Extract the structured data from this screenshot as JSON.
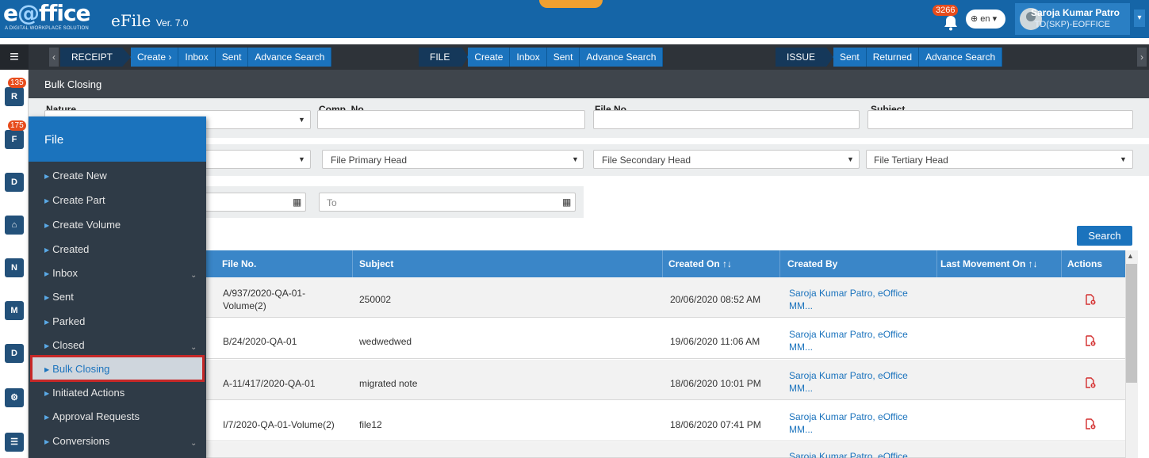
{
  "header": {
    "logo_text_prefix": "e",
    "logo_text_o": "@",
    "logo_text_suffix": "ffice",
    "logo_tagline": "A DIGITAL WORKPLACE SOLUTION",
    "app_title": "eFile",
    "version": "Ver. 7.0",
    "notification_count": "3266",
    "language": "en",
    "user_name": "Saroja Kumar Patro",
    "user_org": "TD(SKP)-EOFFICE"
  },
  "nav": {
    "receipt": {
      "label": "RECEIPT",
      "items": [
        "Create ›",
        "Inbox",
        "Sent",
        "Advance Search"
      ]
    },
    "file": {
      "label": "FILE",
      "items": [
        "Create",
        "Inbox",
        "Sent",
        "Advance Search"
      ]
    },
    "issue": {
      "label": "ISSUE",
      "items": [
        "Sent",
        "Returned",
        "Advance Search"
      ]
    }
  },
  "rail": {
    "receipt_badge": "135",
    "file_badge": "175",
    "icons": [
      "receipt-icon",
      "file-icon",
      "dispatch-icon",
      "inbox-tray-icon",
      "note-icon",
      "movement-icon",
      "dsc-icon",
      "settings-icon",
      "reports-icon"
    ]
  },
  "page": {
    "title": "Bulk Closing"
  },
  "form": {
    "nature_label": "Nature",
    "comp_no_label": "Comp. No.",
    "file_no_label": "File No.",
    "subject_label": "Subject",
    "primary_head": "File Primary Head",
    "secondary_head": "File Secondary Head",
    "tertiary_head": "File Tertiary Head",
    "to_placeholder": "To",
    "search_button": "Search"
  },
  "table": {
    "headers": {
      "file_no": "File No.",
      "subject": "Subject",
      "created_on": "Created On ↑↓",
      "created_by": "Created By",
      "last_movement": "Last Movement On ↑↓",
      "actions": "Actions"
    },
    "rows": [
      {
        "file_no_1": "A/937/2020-QA-01-",
        "file_no_2": "Volume(2)",
        "subject": "250002",
        "created_on": "20/06/2020 08:52 AM",
        "created_by_1": "Saroja Kumar Patro, eOffice",
        "created_by_2": "MM..."
      },
      {
        "file_no_1": "B/24/2020-QA-01",
        "file_no_2": "",
        "subject": "wedwedwed",
        "created_on": "19/06/2020 11:06 AM",
        "created_by_1": "Saroja Kumar Patro, eOffice",
        "created_by_2": "MM..."
      },
      {
        "file_no_1": "A-11/417/2020-QA-01",
        "file_no_2": "",
        "subject": "migrated note",
        "created_on": "18/06/2020 10:01 PM",
        "created_by_1": "Saroja Kumar Patro, eOffice",
        "created_by_2": "MM..."
      },
      {
        "file_no_1": "I/7/2020-QA-01-Volume(2)",
        "file_no_2": "",
        "subject": "file12",
        "created_on": "18/06/2020 07:41 PM",
        "created_by_1": "Saroja Kumar Patro, eOffice",
        "created_by_2": "MM..."
      },
      {
        "file_no_1": "",
        "file_no_2": "",
        "subject": "",
        "created_on": "",
        "created_by_1": "Saroja Kumar Patro, eOffice",
        "created_by_2": ""
      }
    ]
  },
  "side_menu": {
    "title": "File",
    "items": [
      {
        "label": "Create New",
        "has_chevron": false
      },
      {
        "label": "Create Part",
        "has_chevron": false
      },
      {
        "label": "Create Volume",
        "has_chevron": false
      },
      {
        "label": "Created",
        "has_chevron": false
      },
      {
        "label": "Inbox",
        "has_chevron": true
      },
      {
        "label": "Sent",
        "has_chevron": false
      },
      {
        "label": "Parked",
        "has_chevron": false
      },
      {
        "label": "Closed",
        "has_chevron": true
      },
      {
        "label": "Bulk Closing",
        "has_chevron": false,
        "active": true
      },
      {
        "label": "Initiated Actions",
        "has_chevron": false
      },
      {
        "label": "Approval Requests",
        "has_chevron": false
      },
      {
        "label": "Conversions",
        "has_chevron": true
      }
    ]
  },
  "colors": {
    "header_blue": "#1565a7",
    "accent_blue": "#1b73bd",
    "active_highlight": "#c62828",
    "badge": "#e74c1c"
  }
}
